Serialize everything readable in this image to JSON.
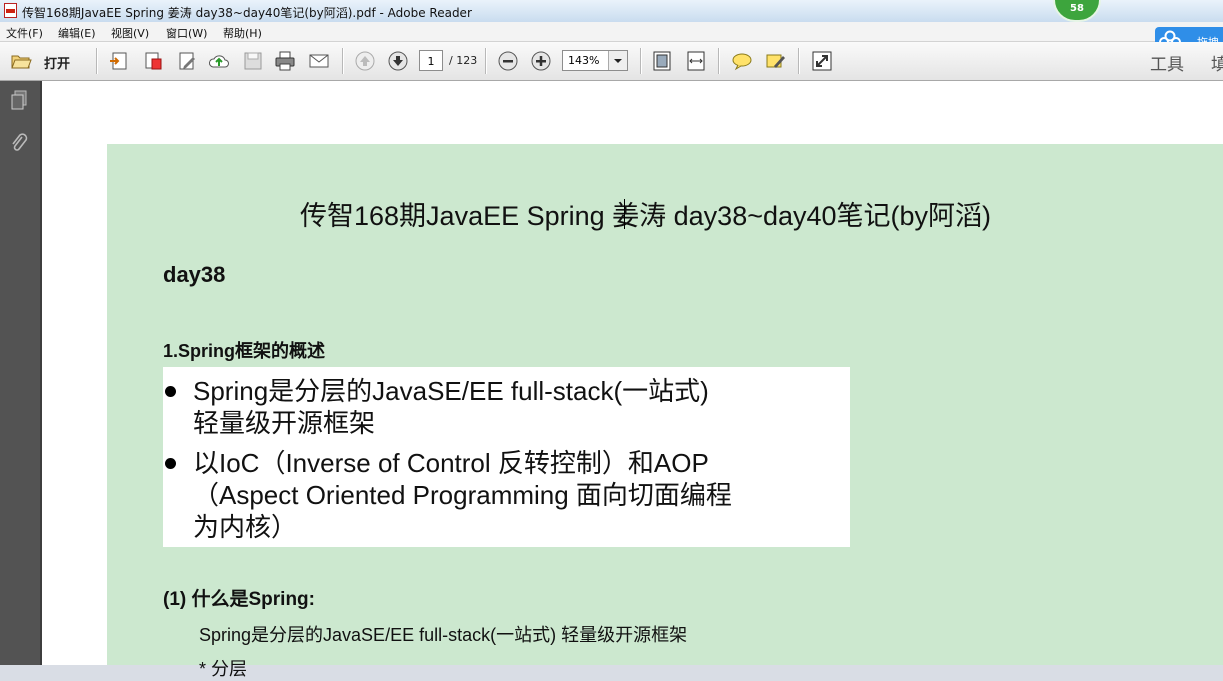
{
  "window": {
    "title": "传智168期JavaEE Spring  姜涛 day38~day40笔记(by阿滔).pdf - Adobe Reader",
    "badge": "58"
  },
  "menu": [
    "文件(F)",
    "编辑(E)",
    "视图(V)",
    "窗口(W)",
    "帮助(H)"
  ],
  "cloud_button": {
    "label": "拖拽"
  },
  "toolbar": {
    "open_label": "打开",
    "page_current": "1",
    "page_total": "/ 123",
    "zoom": "143%",
    "tools_label": "工具",
    "fill_label": "填"
  },
  "document": {
    "title": "传智168期JavaEE Spring 姜涛 day38~day40笔记(by阿滔)",
    "day_heading": "day38",
    "section_heading": "1.Spring框架的概述",
    "bullets": [
      {
        "line1": "Spring是分层的JavaSE/EE full-stack(一站式)",
        "line2": "轻量级开源框架"
      },
      {
        "line1": "以IoC（Inverse of Control 反转控制）和AOP",
        "line2": "（Aspect Oriented Programming 面向切面编程",
        "line3": "为内核）"
      }
    ],
    "q1_heading": "(1)   什么是Spring:",
    "q1_body": "Spring是分层的JavaSE/EE full-stack(一站式) 轻量级开源框架",
    "q1_next": "* 分层"
  }
}
